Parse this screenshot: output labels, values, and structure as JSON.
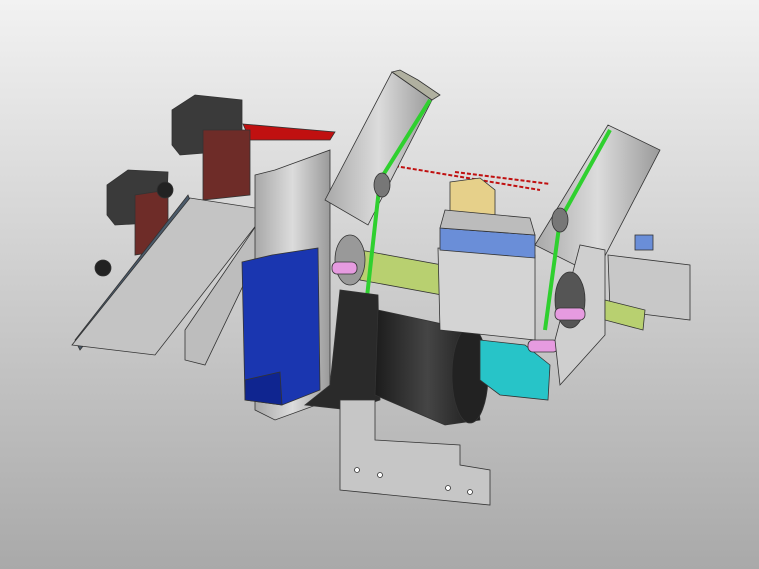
{
  "scene": {
    "subject": "cad-mechanical-assembly-render",
    "colors": {
      "background_top": "#f2f2f2",
      "background_bottom": "#a9a9a9",
      "aluminum": "#c8c8c8",
      "aluminum_dark": "#8e8e8e",
      "motor_black": "#2a2a2a",
      "cover_blue": "#1a36b0",
      "belt_green": "#2fd02f",
      "bracket_maroon": "#6e2c28",
      "beam_red": "#c01010",
      "block_cyan": "#27c4c8",
      "bar_lime": "#b8d070",
      "pin_pink": "#e69be0",
      "bar_blue": "#6a8ed8",
      "block_tan": "#e6d08a",
      "box_dark": "#3a3a3a"
    }
  }
}
